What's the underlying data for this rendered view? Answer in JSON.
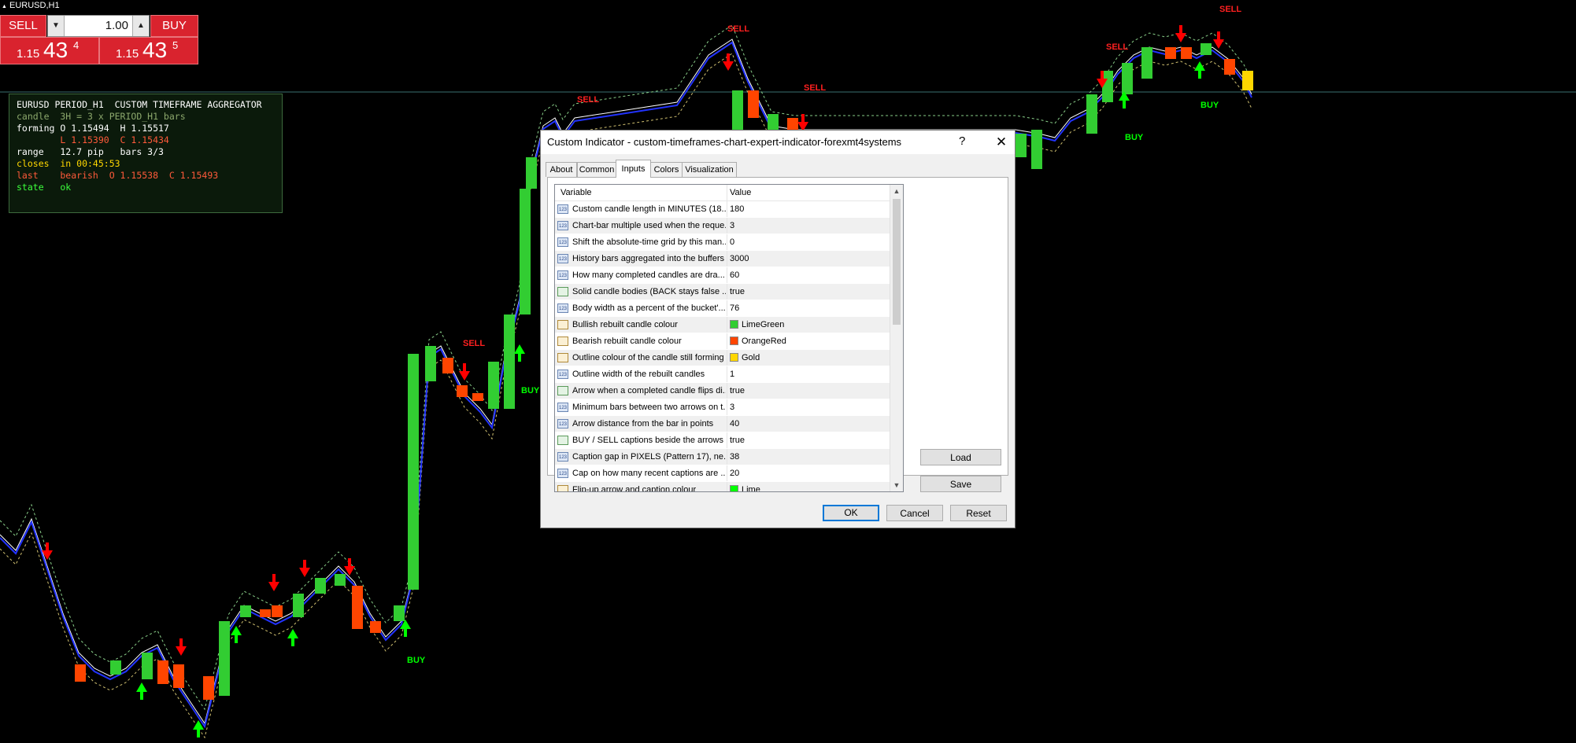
{
  "chart": {
    "title": "EURUSD,H1",
    "signal_labels": [
      "SELL",
      "SELL",
      "SELL",
      "SELL",
      "SELL",
      "SELL",
      "BUY",
      "BUY",
      "BUY",
      "BUY"
    ],
    "colors": {
      "bull": "#32cd32",
      "bear": "#ff4500",
      "forming": "#ffd700",
      "arrow_up": "#00ff00",
      "arrow_down": "#ff0000",
      "grid_line": "#3a6f6f"
    }
  },
  "trade_panel": {
    "sell_label": "SELL",
    "buy_label": "BUY",
    "lot_value": "1.00",
    "bid_small": "1.15",
    "bid_big": "43",
    "bid_sup": "4",
    "ask_small": "1.15",
    "ask_big": "43",
    "ask_sup": "5"
  },
  "info_panel": {
    "lines": [
      "EURUSD PERIOD_H1  CUSTOM TIMEFRAME AGGREGATOR",
      "candle  3H = 3 x PERIOD_H1 bars",
      "forming O 1.15494  H 1.15517",
      "        L 1.15390  C 1.15434",
      "range   12.7 pip   bars 3/3",
      "closes  in 00:45:53",
      "last    bearish  O 1.15538  C 1.15493",
      "state   ok"
    ]
  },
  "dialog": {
    "title": "Custom Indicator - custom-timeframes-chart-expert-indicator-forexmt4systems",
    "help": "?",
    "close": "✕",
    "tabs": [
      "About",
      "Common",
      "Inputs",
      "Colors",
      "Visualization"
    ],
    "columns": [
      "Variable",
      "Value"
    ],
    "rows": [
      {
        "type": "int",
        "variable": "Custom candle length in MINUTES (18...",
        "value": "180"
      },
      {
        "type": "int",
        "variable": "Chart-bar multiple used when the reque...",
        "value": "3"
      },
      {
        "type": "int",
        "variable": "Shift the absolute-time grid by this man...",
        "value": "0"
      },
      {
        "type": "int",
        "variable": "History bars aggregated into the buffers",
        "value": "3000"
      },
      {
        "type": "int",
        "variable": "How many completed candles are dra...",
        "value": "60"
      },
      {
        "type": "bool",
        "variable": "Solid candle bodies (BACK stays false ...",
        "value": "true"
      },
      {
        "type": "int",
        "variable": "Body width as a percent of the bucket'...",
        "value": "76"
      },
      {
        "type": "color",
        "variable": "Bullish rebuilt candle colour",
        "value": "LimeGreen",
        "swatch": "#32cd32"
      },
      {
        "type": "color",
        "variable": "Bearish rebuilt candle colour",
        "value": "OrangeRed",
        "swatch": "#ff4500"
      },
      {
        "type": "color",
        "variable": "Outline colour of the candle still forming",
        "value": "Gold",
        "swatch": "#ffd700"
      },
      {
        "type": "int",
        "variable": "Outline width of the rebuilt candles",
        "value": "1"
      },
      {
        "type": "bool",
        "variable": "Arrow when a completed candle flips di...",
        "value": "true"
      },
      {
        "type": "int",
        "variable": "Minimum bars between two arrows on t...",
        "value": "3"
      },
      {
        "type": "int",
        "variable": "Arrow distance from the bar in points",
        "value": "40"
      },
      {
        "type": "bool",
        "variable": "BUY / SELL captions beside the arrows",
        "value": "true"
      },
      {
        "type": "int",
        "variable": "Caption gap in PIXELS (Pattern 17), ne...",
        "value": "38"
      },
      {
        "type": "int",
        "variable": "Cap on how many recent captions are ...",
        "value": "20"
      },
      {
        "type": "color",
        "variable": "Flip-up arrow and caption colour",
        "value": "Lime",
        "swatch": "#00ff00"
      }
    ],
    "buttons": {
      "load": "Load",
      "save": "Save",
      "ok": "OK",
      "cancel": "Cancel",
      "reset": "Reset"
    }
  }
}
